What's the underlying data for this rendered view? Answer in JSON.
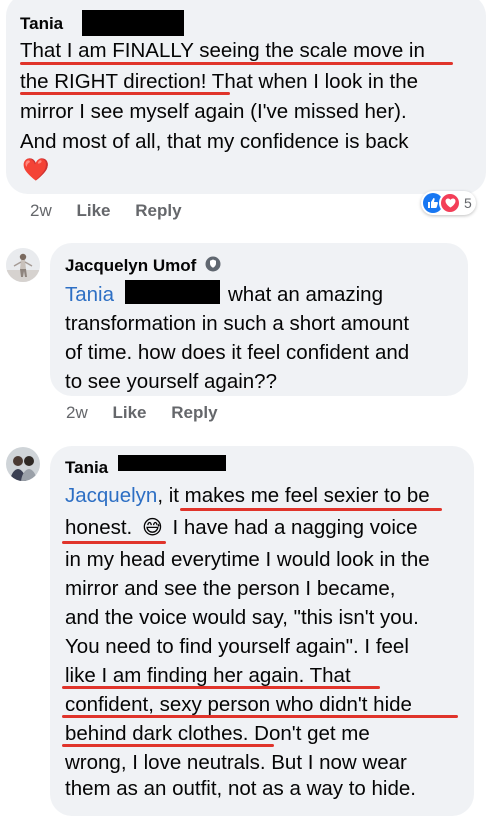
{
  "comments": [
    {
      "author": "Tania",
      "lines": [
        "That I am FINALLY seeing the scale move in",
        "the RIGHT direction! That when I look in the",
        "mirror I see myself again (I've missed her).",
        "And most of all, that my confidence is back"
      ],
      "emoji": "❤️",
      "time": "2w",
      "like_label": "Like",
      "reply_label": "Reply",
      "reaction_count": "5",
      "reaction_icons": [
        "thumbs-up-icon",
        "heart-icon"
      ],
      "colors": {
        "like": "#1877f2",
        "love": "#f33e58"
      }
    },
    {
      "author": "Jacquelyn Umof",
      "badge_icon": "shield-badge-icon",
      "mention": "Tania",
      "lines": [
        "what an amazing",
        "transformation in such a short amount",
        "of time. how does it feel confident and",
        "to see yourself again??"
      ],
      "time": "2w",
      "like_label": "Like",
      "reply_label": "Reply"
    },
    {
      "author": "Tania",
      "mention": "Jacquelyn",
      "line1_rest": ", it makes me feel sexier to be",
      "line2_text": "honest.",
      "line2_emoji": "😅",
      "line2_rest": "I have had a nagging voice",
      "lines": [
        "in my head everytime I would look in the",
        "mirror and see the person I became,",
        "and the voice would say, \"this isn't you.",
        "You need to find yourself again\". I feel",
        "like I am finding her again. That",
        "confident, sexy person who didn't hide",
        "behind dark clothes. Don't get me",
        "wrong, I love neutrals. But I now wear",
        "them as an outfit, not as a way to hide."
      ]
    }
  ],
  "colors": {
    "bubble": "#f0f2f5",
    "mention": "#2d6fc4",
    "underline": "#e0342b",
    "meta_text": "#65676b"
  }
}
